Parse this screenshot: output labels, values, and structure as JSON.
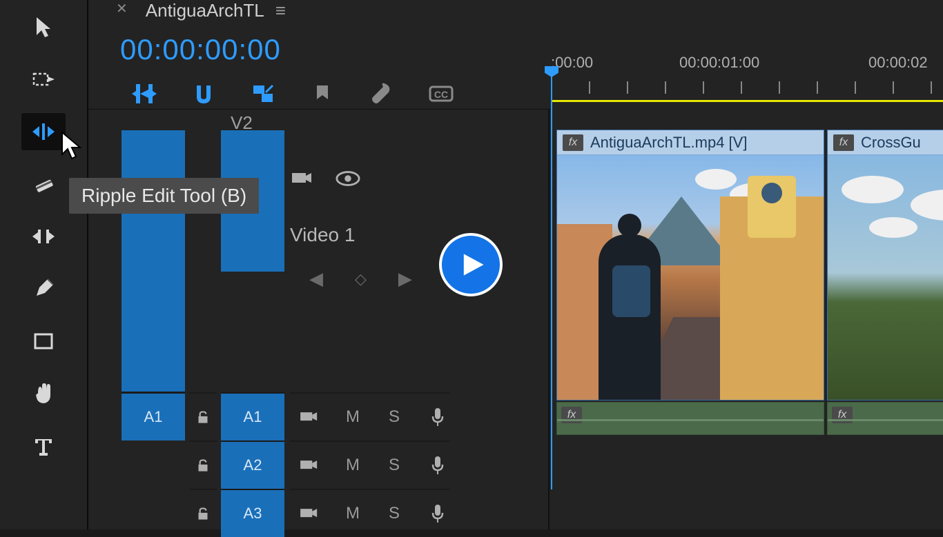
{
  "sequence": {
    "name": "AntiguaArchTL",
    "timecode": "00:00:00:00"
  },
  "tooltip": "Ripple Edit Tool (B)",
  "ruler": {
    "labels": [
      ":00:00",
      "00:00:01:00",
      "00:00:02"
    ]
  },
  "tracks": {
    "v2_label": "V2",
    "video1_label": "Video 1",
    "audio_src": "A1",
    "audio_targets": [
      "A1",
      "A2",
      "A3"
    ],
    "mute": "M",
    "solo": "S"
  },
  "clips": [
    {
      "name": "AntiguaArchTL.mp4 [V]"
    },
    {
      "name": "CrossGu"
    }
  ],
  "icons": {
    "selection": "selection",
    "track_select": "track-select",
    "ripple": "ripple",
    "razor": "razor",
    "slip": "slip",
    "pen": "pen",
    "rect": "rectangle",
    "hand": "hand",
    "type": "type"
  }
}
